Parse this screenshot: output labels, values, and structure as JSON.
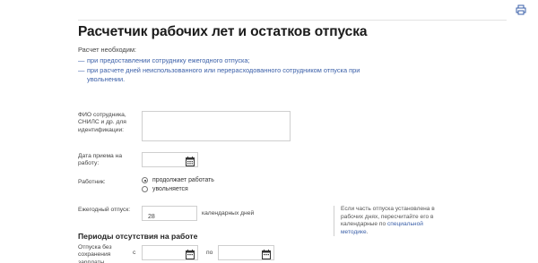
{
  "title": "Расчетчик рабочих лет и остатков отпуска",
  "intro": "Расчет необходим:",
  "links": [
    {
      "dash": "—",
      "text": "при предоставлении сотруднику ежегодного отпуска;"
    },
    {
      "dash": "—",
      "text": "при расчете дней неиспользованного или перерасходованного сотрудником отпуска при увольнении."
    }
  ],
  "fields": {
    "fio_label": "ФИО сотрудника, СНИЛС и др. для идентификации:",
    "fio_value": "",
    "hire_label": "Дата приема на работу:",
    "hire_value": "",
    "worker_label": "Работник:",
    "worker_options": [
      "продолжает работать",
      "увольняется"
    ],
    "worker_selected": "продолжает работать",
    "leave_label": "Ежегодный отпуск:",
    "leave_value": "28",
    "leave_units": "календарных дней"
  },
  "note": {
    "text": "Если часть отпуска установлена в рабочих днях, пересчитайте его в календарные по ",
    "link": "специальной методике",
    "tail": "."
  },
  "absence": {
    "heading": "Периоды отсутствия на работе",
    "row_label": "Отпуска без сохранения зарплаты",
    "from": "с",
    "to": "по"
  },
  "icons": {
    "print": "print-icon",
    "calendar": "calendar-icon"
  },
  "colors": {
    "link": "#3a5fa8",
    "text": "#222222",
    "border": "#cfcfcf"
  }
}
